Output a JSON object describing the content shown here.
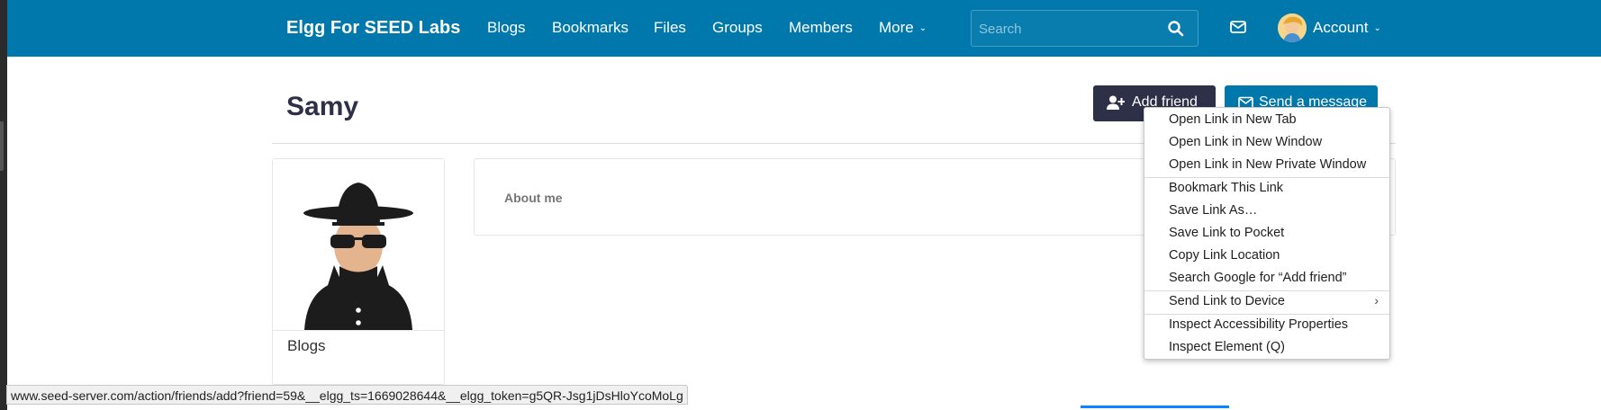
{
  "header": {
    "brand": "Elgg For SEED Labs",
    "nav": [
      "Blogs",
      "Bookmarks",
      "Files",
      "Groups",
      "Members"
    ],
    "more_label": "More",
    "search_placeholder": "Search",
    "account_label": "Account",
    "accent_color": "#0078ac"
  },
  "profile": {
    "name": "Samy",
    "add_friend_label": "Add friend",
    "send_message_label": "Send a message",
    "about_label": "About me",
    "menu_item_blogs": "Blogs"
  },
  "context_menu": {
    "items": [
      "Open Link in New Tab",
      "Open Link in New Window",
      "Open Link in New Private Window",
      "Bookmark This Link",
      "Save Link As…",
      "Save Link to Pocket",
      "Copy Link Location",
      "Search Google for “Add friend”",
      "Send Link to Device",
      "Inspect Accessibility Properties",
      "Inspect Element (Q)"
    ]
  },
  "status_url": "www.seed-server.com/action/friends/add?friend=59&__elgg_ts=1669028644&__elgg_token=g5QR-Jsg1jDsHloYcoMoLg"
}
